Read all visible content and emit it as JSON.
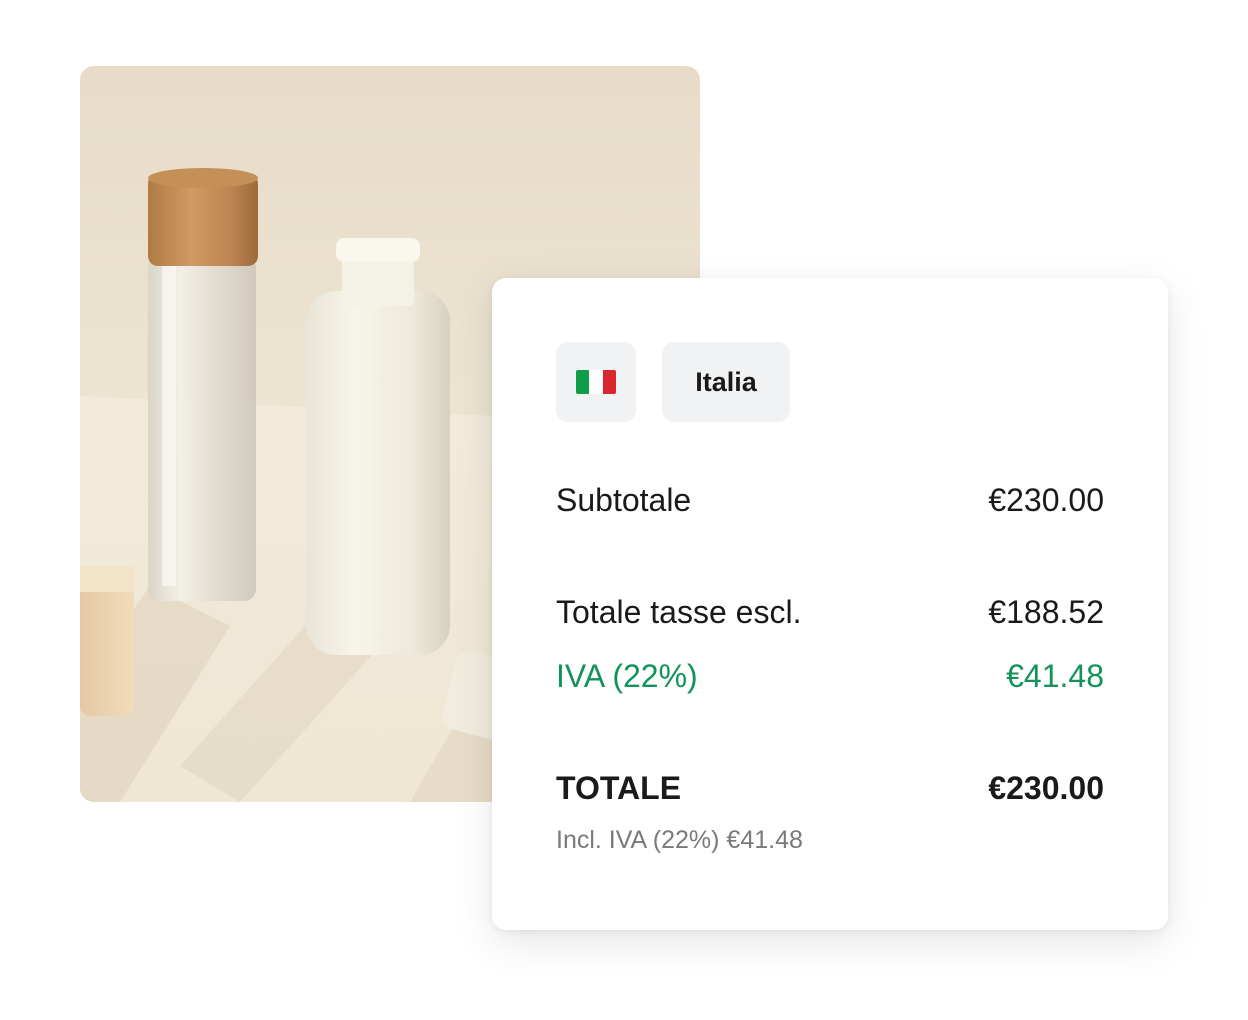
{
  "image": {
    "alt": "Cosmetic bottles product photo"
  },
  "country": {
    "name": "Italia",
    "flag_icon": "italy-flag-icon",
    "flag_colors": [
      "#0f9d49",
      "#ffffff",
      "#d9262f"
    ]
  },
  "summary": {
    "subtotal_label": "Subtotale",
    "subtotal_value": "€230.00",
    "excl_label": "Totale tasse escl.",
    "excl_value": "€188.52",
    "vat_label": "IVA (22%)",
    "vat_value": "€41.48",
    "total_label": "TOTALE",
    "total_value": "€230.00",
    "total_note": "Incl. IVA (22%) €41.48"
  },
  "colors": {
    "vat_green": "#12935a",
    "text": "#1a1a1a",
    "muted": "#7a7a7a",
    "chip_bg": "#f1f2f4"
  }
}
